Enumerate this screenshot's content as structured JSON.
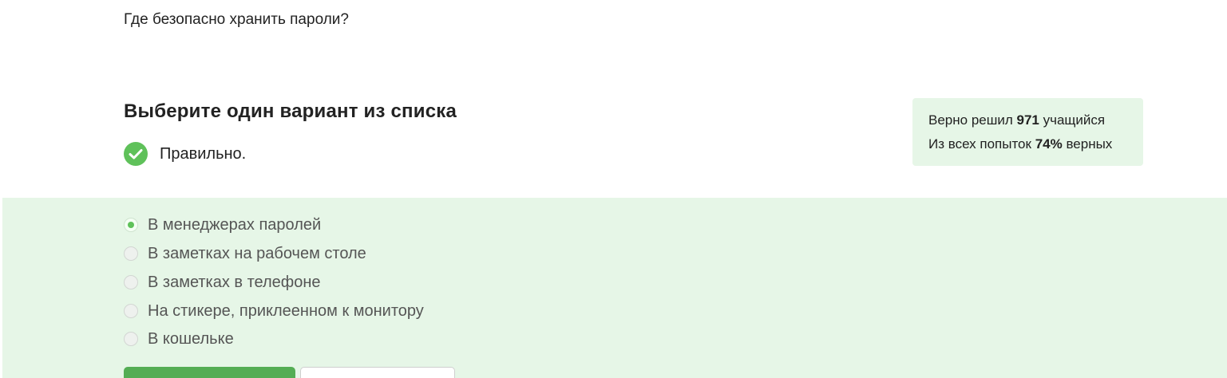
{
  "question": {
    "text": "Где безопасно хранить пароли?"
  },
  "task": {
    "title": "Выберите один вариант из списка",
    "status_text": "Правильно.",
    "status_icon": "check-circle-icon",
    "status_color": "#5fc15a"
  },
  "stats": {
    "line1_prefix": "Верно решил",
    "line1_count": "971",
    "line1_suffix": "учащийся",
    "line2_prefix": "Из всех попыток",
    "line2_percent": "74%",
    "line2_suffix": "верных",
    "background": "#e6f6e7"
  },
  "options": [
    {
      "label": "В менеджерах паролей",
      "selected": true
    },
    {
      "label": "В заметках на рабочем столе",
      "selected": false
    },
    {
      "label": "В заметках в телефоне",
      "selected": false
    },
    {
      "label": "На стикере, приклеенном к монитору",
      "selected": false
    },
    {
      "label": "В кошельке",
      "selected": false
    }
  ],
  "colors": {
    "accent": "#54ad54",
    "answers_background": "#e6f6e7"
  }
}
